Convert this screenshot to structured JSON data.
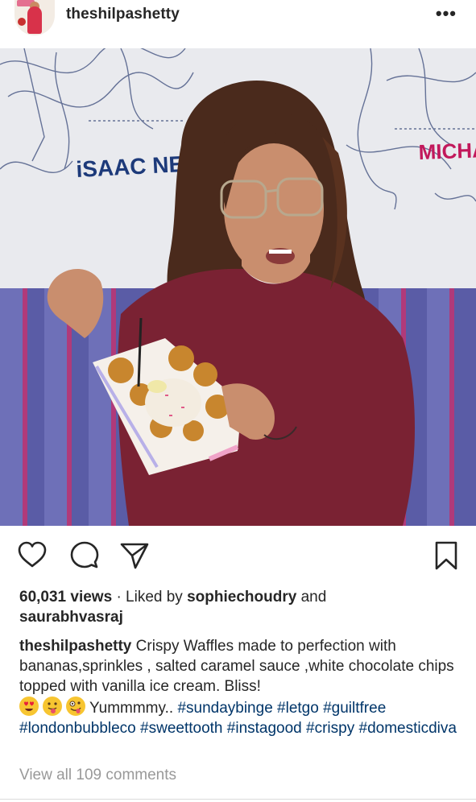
{
  "header": {
    "username": "theshilpashetty",
    "more_label": "•••"
  },
  "media": {
    "wall_names": [
      "iSAAC NEW",
      "MICHA"
    ]
  },
  "actions": {
    "icons": [
      "heart-icon",
      "comment-icon",
      "share-icon",
      "bookmark-icon"
    ]
  },
  "stats": {
    "views": "60,031 views",
    "liked_by_prefix": "· Liked by",
    "liked_user": "sophiechoudry",
    "and": "and",
    "liked_user_2": "saurabhvasraj"
  },
  "caption": {
    "username": "theshilpashetty",
    "text_1": "Crispy Waffles made to perfection with bananas,sprinkles , salted caramel sauce ,white chocolate chips topped with vanilla ice cream. Bliss!",
    "emojis": [
      "heart-eyes-emoji",
      "tongue-out-emoji",
      "zany-face-emoji"
    ],
    "text_2": "Yummmmy..",
    "hashtags": [
      "#sundaybinge",
      "#letgo",
      "#guiltfree",
      "#londonbubbleco",
      "#sweettooth",
      "#instagood",
      "#crispy",
      "#domesticdiva"
    ]
  },
  "comments": {
    "view_all": "View all 109 comments"
  },
  "colors": {
    "text": "#262626",
    "hashtag": "#003569",
    "muted": "#999999"
  }
}
